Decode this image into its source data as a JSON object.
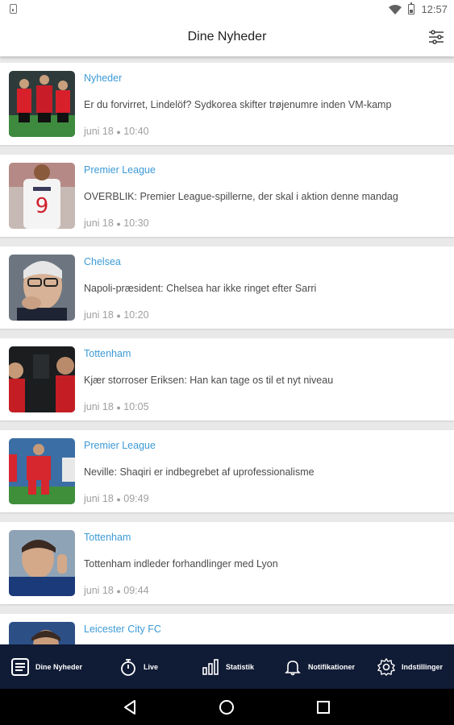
{
  "status_bar": {
    "time": "12:57"
  },
  "app_bar": {
    "title": "Dine Nyheder"
  },
  "articles": [
    {
      "category": "Nyheder",
      "headline": "Er du forvirret, Lindelöf? Sydkorea skifter trøjenumre inden VM-kamp",
      "date": "juni 18",
      "time": "10:40"
    },
    {
      "category": "Premier League",
      "headline": "OVERBLIK: Premier League-spillerne, der skal i aktion denne mandag",
      "date": "juni 18",
      "time": "10:30"
    },
    {
      "category": "Chelsea",
      "headline": "Napoli-præsident: Chelsea har ikke ringet efter Sarri",
      "date": "juni 18",
      "time": "10:20"
    },
    {
      "category": "Tottenham",
      "headline": "Kjær storroser Eriksen: Han kan tage os til et nyt niveau",
      "date": "juni 18",
      "time": "10:05"
    },
    {
      "category": "Premier League",
      "headline": "Neville: Shaqiri er indbegrebet af uprofessionalisme",
      "date": "juni 18",
      "time": "09:49"
    },
    {
      "category": "Tottenham",
      "headline": "Tottenham indleder forhandlinger med Lyon",
      "date": "juni 18",
      "time": "09:44"
    },
    {
      "category": "Leicester City FC"
    }
  ],
  "meta_separator": "●",
  "bottom_nav": {
    "items": [
      {
        "label": "Dine Nyheder",
        "icon": "news-icon"
      },
      {
        "label": "Live",
        "icon": "stopwatch-icon"
      },
      {
        "label": "Statistik",
        "icon": "bar-chart-icon"
      },
      {
        "label": "Notifikationer",
        "icon": "bell-icon"
      },
      {
        "label": "Indstillinger",
        "icon": "gear-icon"
      }
    ]
  },
  "colors": {
    "category": "#3c9ad6",
    "bottom_nav_bg": "#101b35",
    "headline": "#4a4a4a",
    "meta": "#9e9e9e"
  }
}
